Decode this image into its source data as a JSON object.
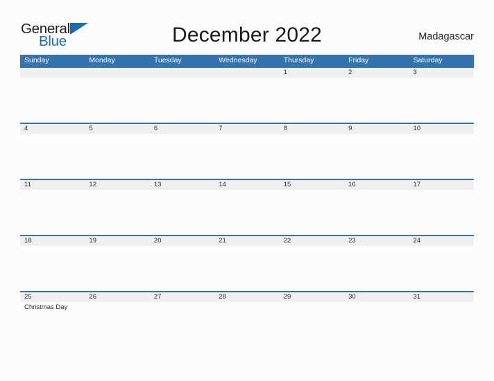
{
  "brand": {
    "name_part1": "General",
    "name_part2": "Blue",
    "flag_icon": "blue-triangle-flag-icon",
    "color_dark": "#231f20",
    "color_blue": "#1c6cb5"
  },
  "header": {
    "title": "December 2022",
    "country": "Madagascar"
  },
  "theme": {
    "header_blue": "#3273b0",
    "row_divider_blue": "#3273b0",
    "date_band_gray": "#efeff0",
    "page_background": "#fcfcfd"
  },
  "calendar": {
    "weekdays": [
      "Sunday",
      "Monday",
      "Tuesday",
      "Wednesday",
      "Thursday",
      "Friday",
      "Saturday"
    ],
    "weeks": [
      {
        "days": [
          {
            "date": "",
            "events": []
          },
          {
            "date": "",
            "events": []
          },
          {
            "date": "",
            "events": []
          },
          {
            "date": "",
            "events": []
          },
          {
            "date": "1",
            "events": []
          },
          {
            "date": "2",
            "events": []
          },
          {
            "date": "3",
            "events": []
          }
        ]
      },
      {
        "days": [
          {
            "date": "4",
            "events": []
          },
          {
            "date": "5",
            "events": []
          },
          {
            "date": "6",
            "events": []
          },
          {
            "date": "7",
            "events": []
          },
          {
            "date": "8",
            "events": []
          },
          {
            "date": "9",
            "events": []
          },
          {
            "date": "10",
            "events": []
          }
        ]
      },
      {
        "days": [
          {
            "date": "11",
            "events": []
          },
          {
            "date": "12",
            "events": []
          },
          {
            "date": "13",
            "events": []
          },
          {
            "date": "14",
            "events": []
          },
          {
            "date": "15",
            "events": []
          },
          {
            "date": "16",
            "events": []
          },
          {
            "date": "17",
            "events": []
          }
        ]
      },
      {
        "days": [
          {
            "date": "18",
            "events": []
          },
          {
            "date": "19",
            "events": []
          },
          {
            "date": "20",
            "events": []
          },
          {
            "date": "21",
            "events": []
          },
          {
            "date": "22",
            "events": []
          },
          {
            "date": "23",
            "events": []
          },
          {
            "date": "24",
            "events": []
          }
        ]
      },
      {
        "days": [
          {
            "date": "25",
            "events": [
              "Christmas Day"
            ]
          },
          {
            "date": "26",
            "events": []
          },
          {
            "date": "27",
            "events": []
          },
          {
            "date": "28",
            "events": []
          },
          {
            "date": "29",
            "events": []
          },
          {
            "date": "30",
            "events": []
          },
          {
            "date": "31",
            "events": []
          }
        ]
      }
    ]
  }
}
